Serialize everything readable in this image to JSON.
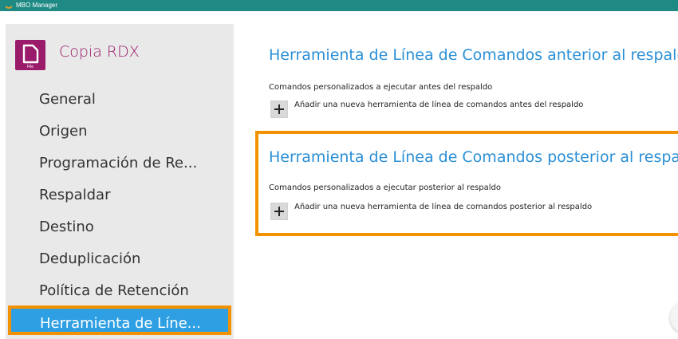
{
  "window": {
    "title": "MBO Manager"
  },
  "sidebar": {
    "title": "Copia RDX",
    "icon_label": "File",
    "items": [
      {
        "label": "General"
      },
      {
        "label": "Origen"
      },
      {
        "label": "Programación de Re..."
      },
      {
        "label": "Respaldar"
      },
      {
        "label": "Destino"
      },
      {
        "label": "Deduplicación"
      },
      {
        "label": "Política de Retención"
      },
      {
        "label": "Herramienta de Líne...",
        "active": true
      }
    ]
  },
  "main": {
    "pre": {
      "title": "Herramienta de Línea de Comandos anterior al respaldo",
      "desc": "Comandos personalizados a ejecutar antes del respaldo",
      "add_label": "Añadir una nueva herramienta de línea de comandos antes del respaldo"
    },
    "post": {
      "title": "Herramienta de Línea de Comandos posterior al respaldo",
      "desc": "Comandos personalizados a ejecutar posterior al respaldo",
      "add_label": "Añadir una nueva herramienta de línea de comandos posterior al respaldo"
    }
  },
  "colors": {
    "titlebar": "#1f8a84",
    "brand": "#9b1b6b",
    "accent": "#2a8fd6",
    "highlight": "#f39200",
    "active_bg": "#2f9fe3"
  }
}
